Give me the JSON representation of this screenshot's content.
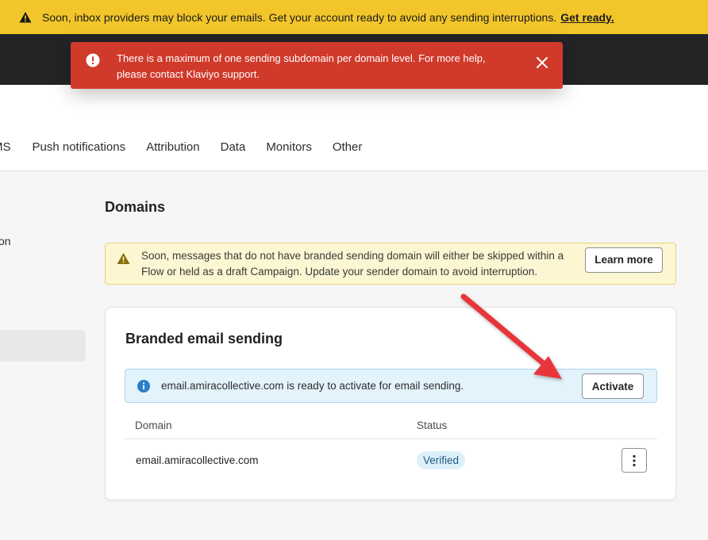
{
  "top_banner": {
    "message": "Soon, inbox providers may block your emails. Get your account ready to avoid any sending interruptions.",
    "link_label": "Get ready.",
    "icon": "warning-icon"
  },
  "toast": {
    "message": "There is a maximum of one sending subdomain per domain level. For more help, please contact Klaviyo support.",
    "icon": "error-icon",
    "close_icon": "close-icon"
  },
  "tabs": [
    "MS",
    "Push notifications",
    "Attribution",
    "Data",
    "Monitors",
    "Other"
  ],
  "sidebar": {
    "partial_item": "on"
  },
  "page": {
    "title": "Domains"
  },
  "warning_box": {
    "text": "Soon, messages that do not have branded sending domain will either be skipped within a Flow or held as a draft Campaign. Update your sender domain to avoid interruption.",
    "button_label": "Learn more"
  },
  "card": {
    "title": "Branded email sending",
    "info_text": "email.amiracollective.com is ready to activate for email sending.",
    "activate_label": "Activate",
    "table": {
      "headers": [
        "Domain",
        "Status"
      ],
      "rows": [
        {
          "domain": "email.amiracollective.com",
          "status": "Verified"
        }
      ]
    }
  },
  "colors": {
    "banner": "#f2c52b",
    "toast": "#d03a2b",
    "arrow": "#e8343a",
    "info": "#2a7fc9"
  }
}
